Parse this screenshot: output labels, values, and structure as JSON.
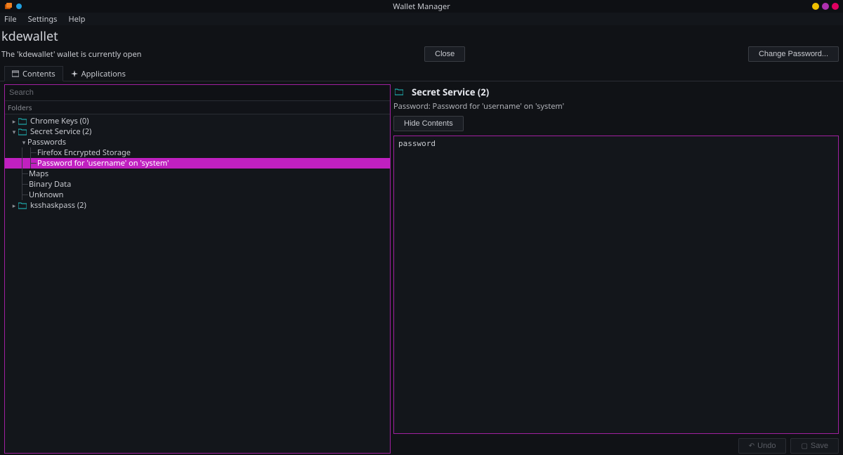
{
  "titlebar": {
    "title": "Wallet Manager",
    "dots": [
      "#f0c000",
      "#b030b0",
      "#e00060"
    ]
  },
  "menu": {
    "file": "File",
    "settings": "Settings",
    "help": "Help"
  },
  "wallet": {
    "name": "kdewallet"
  },
  "status": {
    "text": "The 'kdewallet' wallet is currently open",
    "close": "Close",
    "change_password": "Change Password..."
  },
  "tabs": {
    "contents": "Contents",
    "applications": "Applications"
  },
  "search": {
    "placeholder": "Search"
  },
  "folders_header": "Folders",
  "tree": {
    "chrome": "Chrome Keys (0)",
    "secret": "Secret Service (2)",
    "passwords": "Passwords",
    "firefox": "Firefox Encrypted Storage",
    "pwfor": "Password for 'username' on 'system'",
    "maps": "Maps",
    "binary": "Binary Data",
    "unknown": "Unknown",
    "ksshaskpass": "ksshaskpass (2)"
  },
  "detail": {
    "header": "Secret Service (2)",
    "sublabel": "Password: Password for 'username' on 'system'",
    "hide": "Hide Contents",
    "value": "password"
  },
  "footer": {
    "undo": "Undo",
    "save": "Save"
  },
  "colors": {
    "folder": "#20c8c8"
  }
}
